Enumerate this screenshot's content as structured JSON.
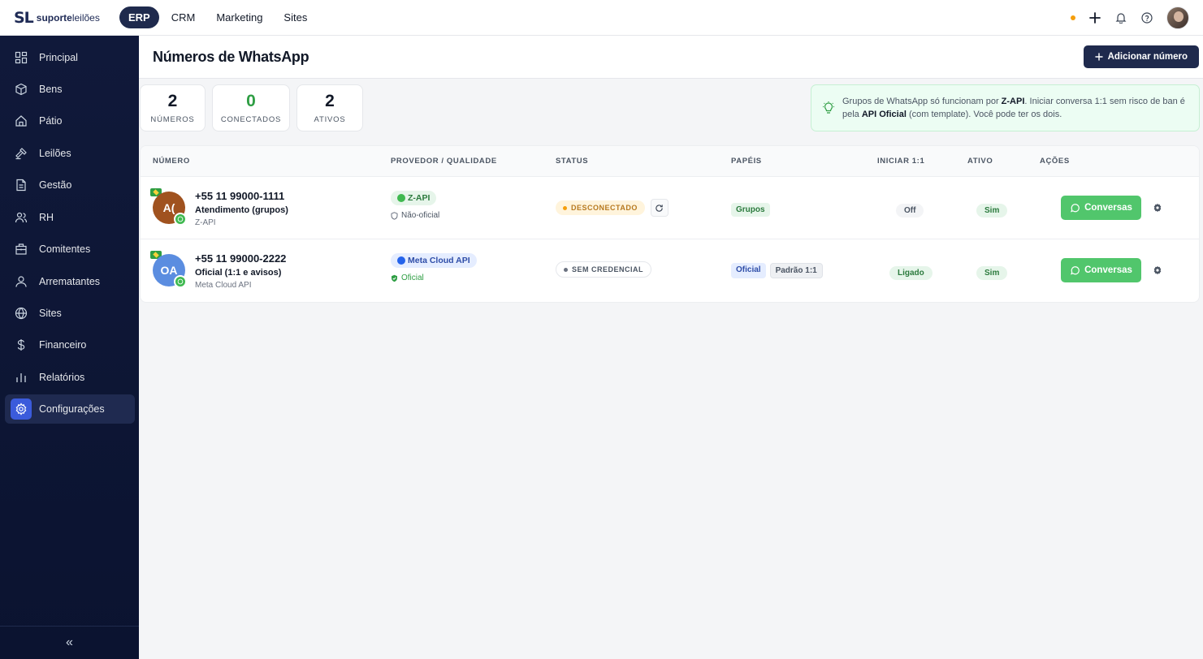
{
  "brand": {
    "mark": "SL",
    "name_bold": "suporte",
    "name_light": "leilões"
  },
  "topnav": {
    "tabs": [
      {
        "label": "ERP",
        "active": true
      },
      {
        "label": "CRM",
        "active": false
      },
      {
        "label": "Marketing",
        "active": false
      },
      {
        "label": "Sites",
        "active": false
      }
    ]
  },
  "topbar_icons": [
    "status-dot",
    "plus-icon",
    "bell-icon",
    "help-icon",
    "user-avatar"
  ],
  "sidebar": {
    "items": [
      {
        "label": "Principal",
        "icon": "dashboard-icon"
      },
      {
        "label": "Bens",
        "icon": "box-icon"
      },
      {
        "label": "Pátio",
        "icon": "home-icon"
      },
      {
        "label": "Leilões",
        "icon": "gavel-icon"
      },
      {
        "label": "Gestão",
        "icon": "document-icon"
      },
      {
        "label": "RH",
        "icon": "users-icon"
      },
      {
        "label": "Comitentes",
        "icon": "building-icon"
      },
      {
        "label": "Arrematantes",
        "icon": "user-icon"
      },
      {
        "label": "Sites",
        "icon": "globe-icon"
      },
      {
        "label": "Financeiro",
        "icon": "dollar-icon"
      },
      {
        "label": "Relatórios",
        "icon": "bar-chart-icon"
      },
      {
        "label": "Configurações",
        "icon": "gear-icon",
        "active": true
      }
    ],
    "collapse_glyph": "«"
  },
  "header": {
    "title": "Números de WhatsApp",
    "add_label": "Adicionar número"
  },
  "stats": [
    {
      "value": "2",
      "label": "NÚMEROS"
    },
    {
      "value": "0",
      "label": "CONECTADOS"
    },
    {
      "value": "2",
      "label": "ATIVOS"
    }
  ],
  "notice": {
    "p1": "Grupos de WhatsApp só funcionam por ",
    "b1": "Z-API",
    "p2": ". Iniciar conversa 1:1 sem risco de ban é pela ",
    "b2": "API Oficial",
    "p3": " (com template). Você pode ter os dois."
  },
  "table": {
    "headers": [
      "NÚMERO",
      "PROVEDOR / QUALIDADE",
      "STATUS",
      "PAPÉIS",
      "INICIAR 1:1",
      "ATIVO",
      "AÇÕES"
    ],
    "rows": [
      {
        "initials": "A(",
        "avatar_color": "#a0521f",
        "phone": "+55 11 99000-1111",
        "alias": "Atendimento (grupos)",
        "provider_sub": "Z-API",
        "provider_pill": "Z-API",
        "quality": "Não-oficial",
        "status": "DESCONECTADO",
        "roles": [
          "Grupos"
        ],
        "start_1_1": "Off",
        "active": "Sim",
        "action_label": "Conversas"
      },
      {
        "initials": "OA",
        "avatar_color": "#5b8de0",
        "phone": "+55 11 99000-2222",
        "alias": "Oficial (1:1 e avisos)",
        "provider_sub": "Meta Cloud API",
        "provider_pill": "Meta Cloud API",
        "quality": "Oficial",
        "status": "SEM CREDENCIAL",
        "roles": [
          "Oficial",
          "Padrão 1:1"
        ],
        "start_1_1": "Ligado",
        "active": "Sim",
        "action_label": "Conversas"
      }
    ]
  }
}
